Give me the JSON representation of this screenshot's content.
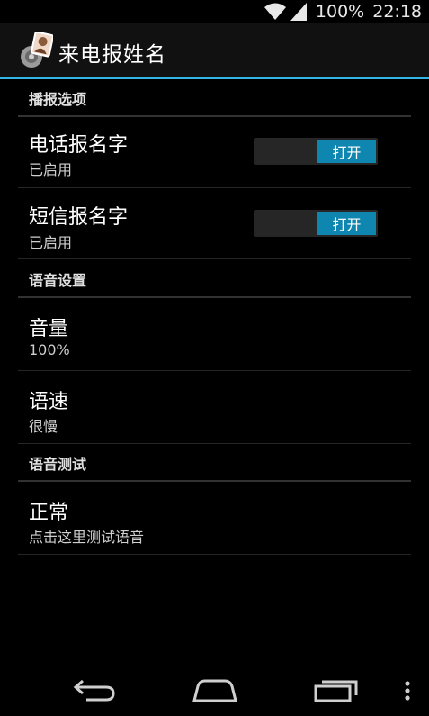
{
  "status_bar": {
    "battery": "100%",
    "time": "22:18"
  },
  "app": {
    "title": "来电报姓名"
  },
  "sections": [
    {
      "header": "播报选项",
      "items": [
        {
          "title": "电话报名字",
          "summary": "已启用",
          "switch_label": "打开"
        },
        {
          "title": "短信报名字",
          "summary": "已启用",
          "switch_label": "打开"
        }
      ]
    },
    {
      "header": "语音设置",
      "items": [
        {
          "title": "音量",
          "summary": "100%"
        },
        {
          "title": "语速",
          "summary": "很慢"
        }
      ]
    },
    {
      "header": "语音测试",
      "items": [
        {
          "title": "正常",
          "summary": "点击这里测试语音"
        }
      ]
    }
  ],
  "icons": {
    "status": [
      "wifi-icon",
      "signal-icon",
      "battery-icon"
    ],
    "navigation": [
      "back-icon",
      "home-icon",
      "recent-apps-icon",
      "overflow-menu-icon"
    ]
  },
  "colors": {
    "accent": "#33b5e5",
    "switch_on": "#0f86b0",
    "background": "#000000"
  }
}
